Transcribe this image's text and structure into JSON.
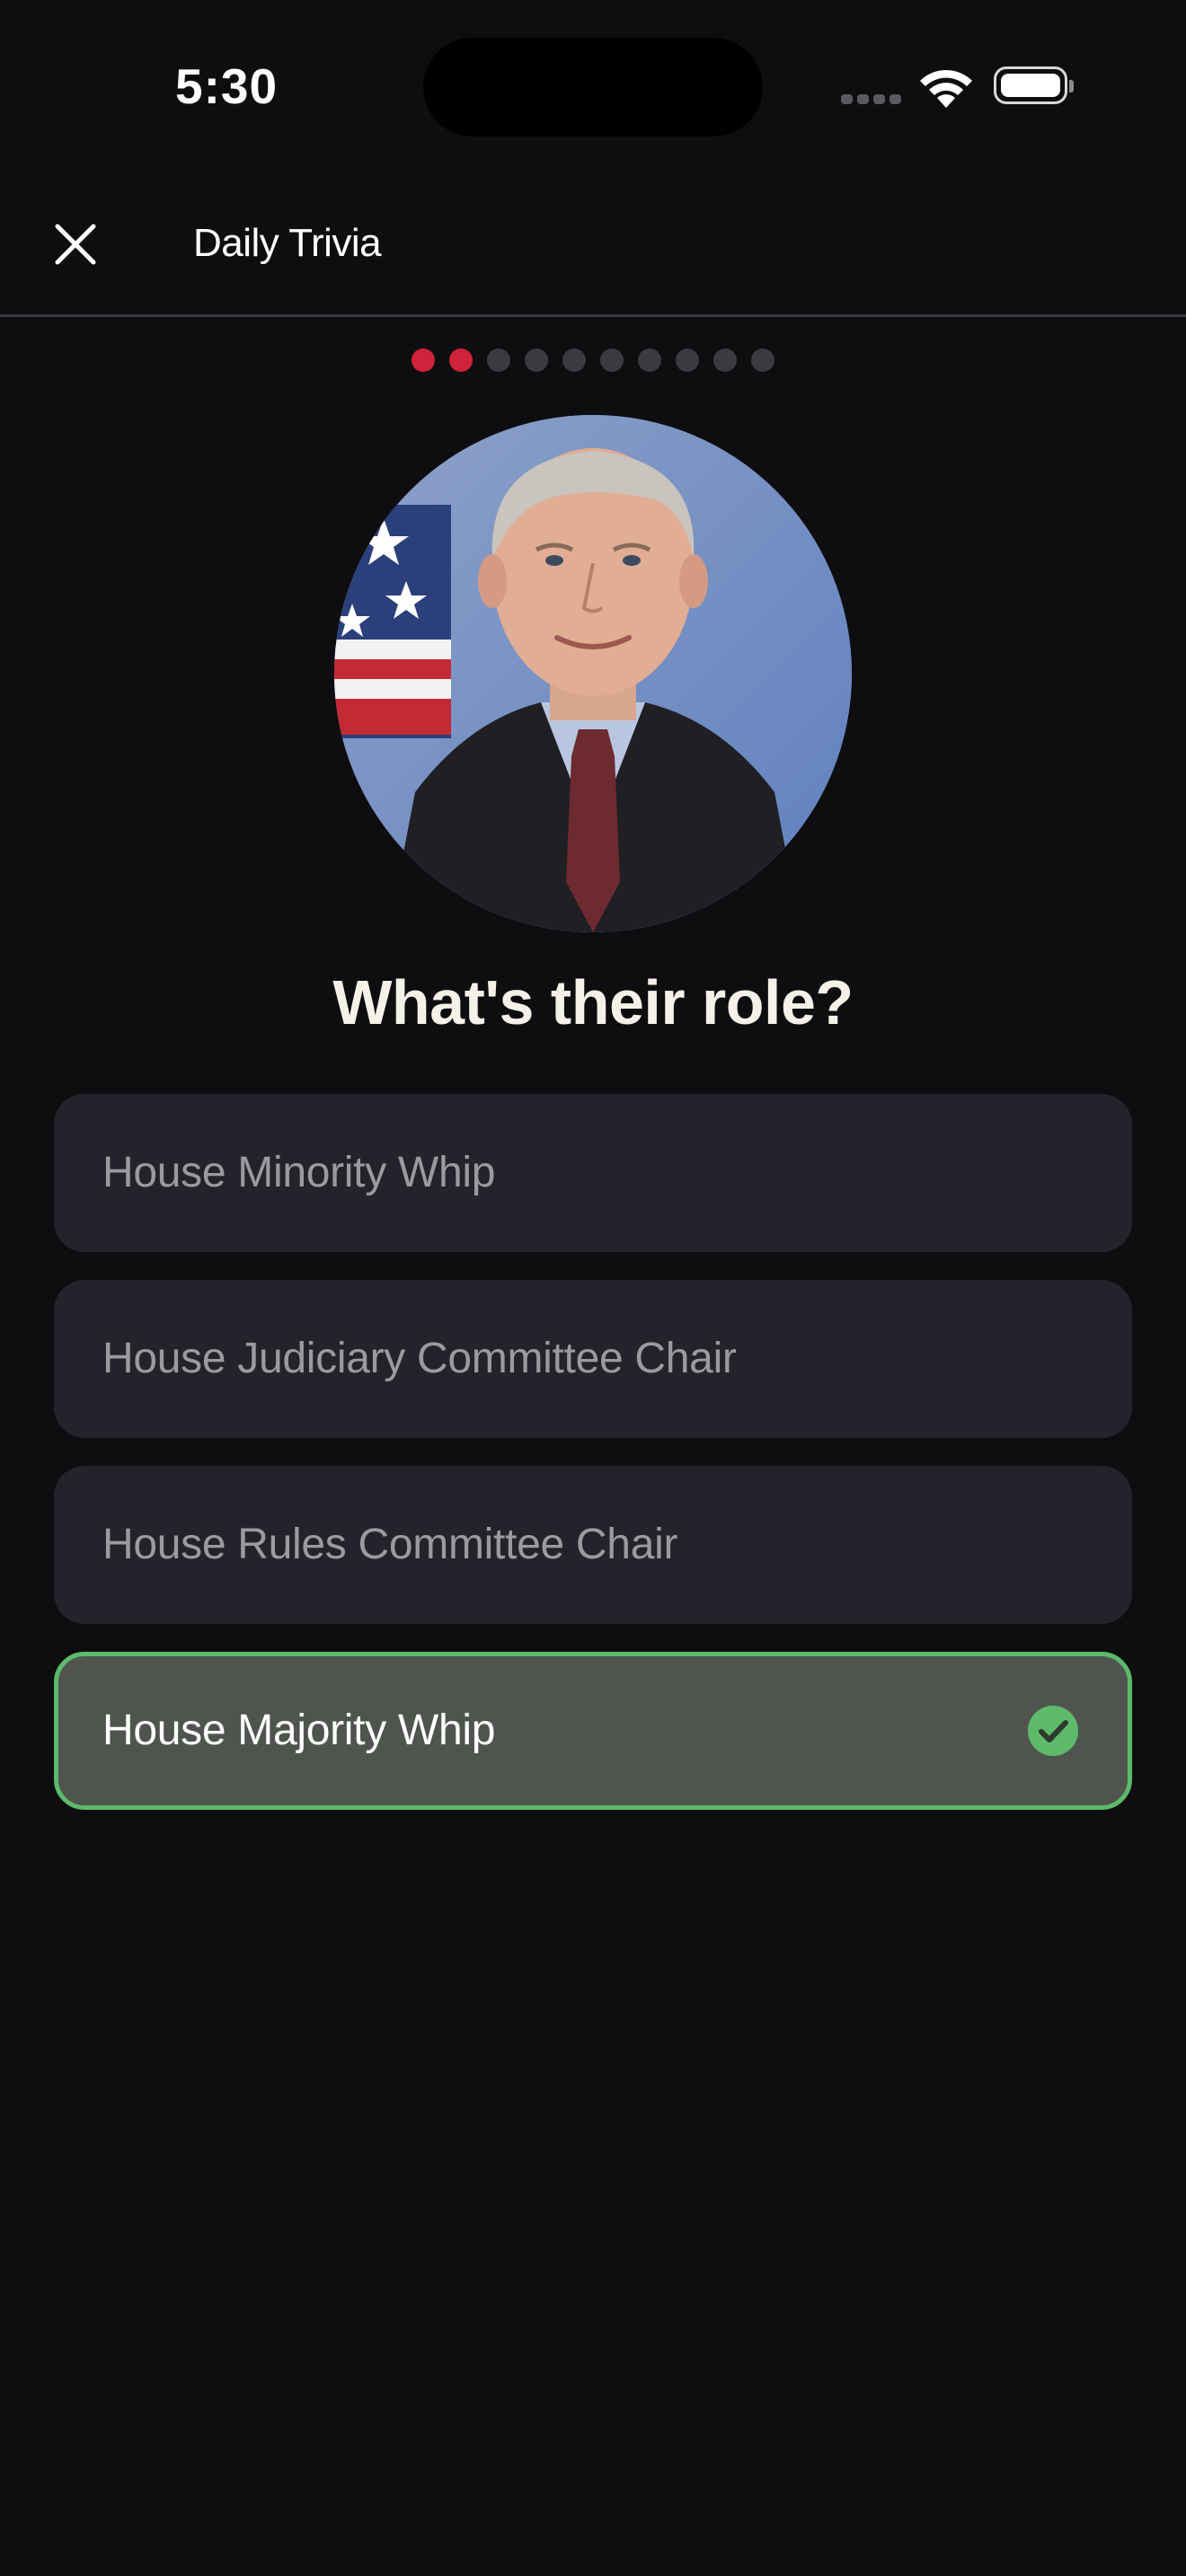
{
  "status_bar": {
    "time": "5:30"
  },
  "header": {
    "title": "Daily Trivia",
    "close_icon": "close-icon"
  },
  "progress": {
    "total": 10,
    "answered": 2,
    "active_color": "#d0223a",
    "inactive_color": "#3a3a40"
  },
  "question": {
    "text": "What's their role?"
  },
  "options": [
    {
      "label": "House Minority Whip",
      "state": "neutral"
    },
    {
      "label": "House Judiciary Committee Chair",
      "state": "neutral"
    },
    {
      "label": "House Rules Committee Chair",
      "state": "neutral"
    },
    {
      "label": "House Majority Whip",
      "state": "correct"
    }
  ],
  "colors": {
    "background": "#0e0e10",
    "option_bg": "#23232b",
    "correct_bg": "#4f554e",
    "correct_border": "#5dba6a"
  }
}
